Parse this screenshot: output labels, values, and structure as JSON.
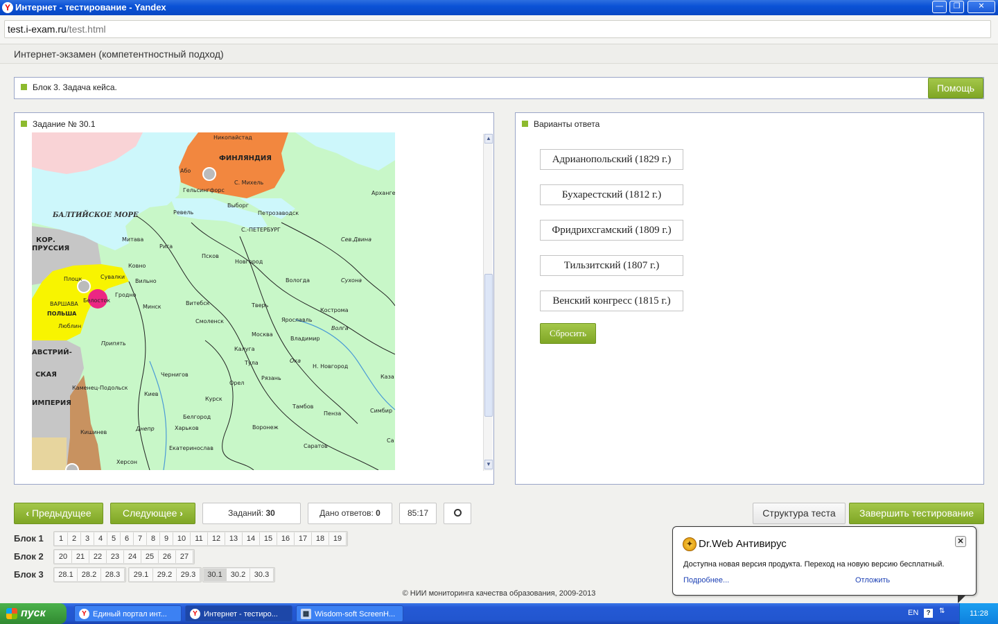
{
  "window": {
    "title": "Интернет - тестирование - Yandex",
    "logo": "Y",
    "controls": [
      "—",
      "❐",
      "✕"
    ]
  },
  "address": {
    "host": "test.i-exam.ru",
    "path": "/test.html"
  },
  "header": {
    "title": "Интернет-экзамен (компетентностный подход)"
  },
  "block_bar": {
    "label": "Блок 3. Задача кейса.",
    "help_label": "Помощь"
  },
  "task_panel": {
    "title": "Задание № 30.1",
    "scroll_up": "▲",
    "scroll_down": "▼",
    "map_labels": {
      "seas": [
        "БАЛТИЙСКОЕ МОРЕ"
      ],
      "regions": [
        "ФИНЛЯНДИЯ",
        "КОР.",
        "ПРУССИЯ",
        "ВАРШАВА",
        "ПОЛЬША",
        "АВСТРИЙ-",
        "СКАЯ",
        "ИМПЕРИЯ"
      ],
      "cities": [
        "Никопайстад",
        "Або",
        "Гельсингфорс",
        "С. Михель",
        "Архангел",
        "Выборг",
        "Петрозаводск",
        "Ревель",
        "С.-ПЕТЕРБУРГ",
        "Митава",
        "Рига",
        "Псков",
        "Новгород",
        "Ковно",
        "Вильно",
        "Сувалки",
        "Плоцк",
        "Гродно",
        "Белосток",
        "Минск",
        "Витебск",
        "Вологда",
        "Тверь",
        "Ярославль",
        "Кострома",
        "Смоленск",
        "Москва",
        "Владимир",
        "Калуга",
        "Тула",
        "Рязань",
        "Н. Новгород",
        "Чернигов",
        "Орел",
        "Каменец-Подольск",
        "Киев",
        "Курск",
        "Тамбов",
        "Пенза",
        "Симбир",
        "Белгород",
        "Харьков",
        "Воронеж",
        "Кишинев",
        "Екатеринослав",
        "Саратов",
        "Херсон",
        "Каза",
        "Са",
        "Люблин"
      ],
      "rivers": [
        "Сев.Двина",
        "Сухона",
        "Волга",
        "Припять",
        "Ока",
        "Днепр"
      ]
    }
  },
  "answer_panel": {
    "title": "Варианты ответа",
    "options": [
      "Адрианопольский (1829 г.)",
      "Бухарестский (1812 г.)",
      "Фридрихсгамский (1809 г.)",
      "Тильзитский (1807 г.)",
      "Венский конгресс (1815 г.)"
    ],
    "reset_label": "Сбросить"
  },
  "nav": {
    "prev_label": "Предыдущее",
    "next_label": "Следующее",
    "tasks_label": "Заданий:",
    "tasks_value": "30",
    "answers_label": "Дано ответов:",
    "answers_value": "0",
    "timer": "85:17",
    "structure_label": "Структура теста",
    "finish_label": "Завершить тестирование"
  },
  "blocks": [
    {
      "label": "Блок 1",
      "groups": [
        [
          "1",
          "2",
          "3",
          "4",
          "5",
          "6",
          "7",
          "8",
          "9",
          "10",
          "11",
          "12",
          "13",
          "14",
          "15",
          "16",
          "17",
          "18",
          "19"
        ]
      ]
    },
    {
      "label": "Блок 2",
      "groups": [
        [
          "20",
          "21",
          "22",
          "23",
          "24",
          "25",
          "26",
          "27"
        ]
      ]
    },
    {
      "label": "Блок 3",
      "groups": [
        [
          "28.1",
          "28.2",
          "28.3"
        ],
        [
          "29.1",
          "29.2",
          "29.3"
        ],
        [
          "30.1",
          "30.2",
          "30.3"
        ]
      ]
    }
  ],
  "active_question": "30.1",
  "footer": {
    "text": "© НИИ мониторинга качества образования, 2009-2013"
  },
  "drweb": {
    "title": "Dr.Web Антивирус",
    "message": "Доступна новая версия продукта. Переход на новую версию бесплатный.",
    "more_link": "Подробнее...",
    "postpone_link": "Отложить"
  },
  "taskbar": {
    "start_label": "пуск",
    "tasks": [
      "Единый портал инт...",
      "Интернет - тестиро...",
      "Wisdom-soft ScreenH..."
    ],
    "active_task_index": 1,
    "lang": "EN",
    "clock": "11:28"
  },
  "colors": {
    "accent_green": "#8dba2e",
    "panel_border": "#9aa5c7",
    "finland": "#f2873f",
    "poland": "#f8f400",
    "austria": "#c6c6c6",
    "russia": "#c8f7c8",
    "sea": "#cdf7fb"
  }
}
